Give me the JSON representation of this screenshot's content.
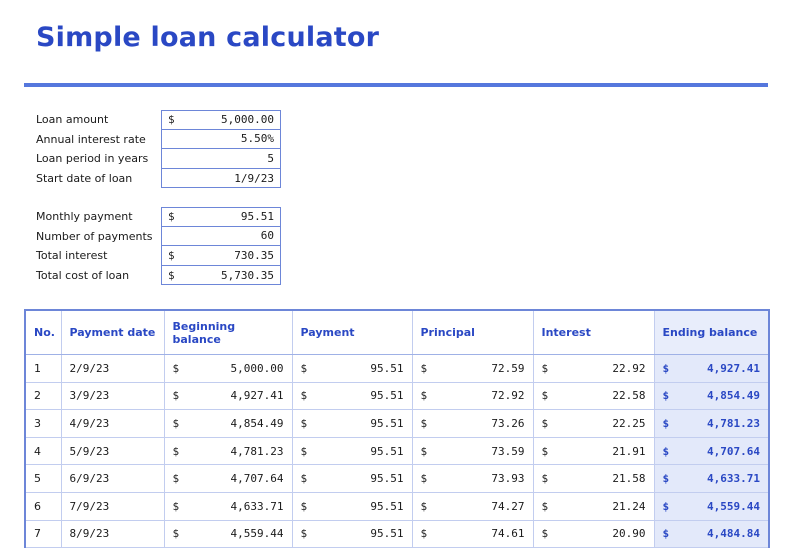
{
  "title": "Simple loan calculator",
  "inputs": [
    {
      "label": "Loan amount",
      "currency": "$",
      "value": "5,000.00"
    },
    {
      "label": "Annual interest rate",
      "currency": "",
      "value": "5.50%"
    },
    {
      "label": "Loan period in years",
      "currency": "",
      "value": "5"
    },
    {
      "label": "Start date of loan",
      "currency": "",
      "value": "1/9/23"
    }
  ],
  "summary": [
    {
      "label": "Monthly payment",
      "currency": "$",
      "value": "95.51"
    },
    {
      "label": "Number of payments",
      "currency": "",
      "value": "60"
    },
    {
      "label": "Total interest",
      "currency": "$",
      "value": "730.35"
    },
    {
      "label": "Total cost of loan",
      "currency": "$",
      "value": "5,730.35"
    }
  ],
  "schedule": {
    "headers": [
      "No.",
      "Payment date",
      "Beginning balance",
      "Payment",
      "Principal",
      "Interest",
      "Ending balance"
    ],
    "currency": "$",
    "rows": [
      [
        "1",
        "2/9/23",
        "5,000.00",
        "95.51",
        "72.59",
        "22.92",
        "4,927.41"
      ],
      [
        "2",
        "3/9/23",
        "4,927.41",
        "95.51",
        "72.92",
        "22.58",
        "4,854.49"
      ],
      [
        "3",
        "4/9/23",
        "4,854.49",
        "95.51",
        "73.26",
        "22.25",
        "4,781.23"
      ],
      [
        "4",
        "5/9/23",
        "4,781.23",
        "95.51",
        "73.59",
        "21.91",
        "4,707.64"
      ],
      [
        "5",
        "6/9/23",
        "4,707.64",
        "95.51",
        "73.93",
        "21.58",
        "4,633.71"
      ],
      [
        "6",
        "7/9/23",
        "4,633.71",
        "95.51",
        "74.27",
        "21.24",
        "4,559.44"
      ],
      [
        "7",
        "8/9/23",
        "4,559.44",
        "95.51",
        "74.61",
        "20.90",
        "4,484.84"
      ]
    ]
  },
  "colors": {
    "accent": "#2a48c4",
    "rule": "#5577dd",
    "border": "#6d86d8",
    "highlight": "#e3e9fa"
  }
}
